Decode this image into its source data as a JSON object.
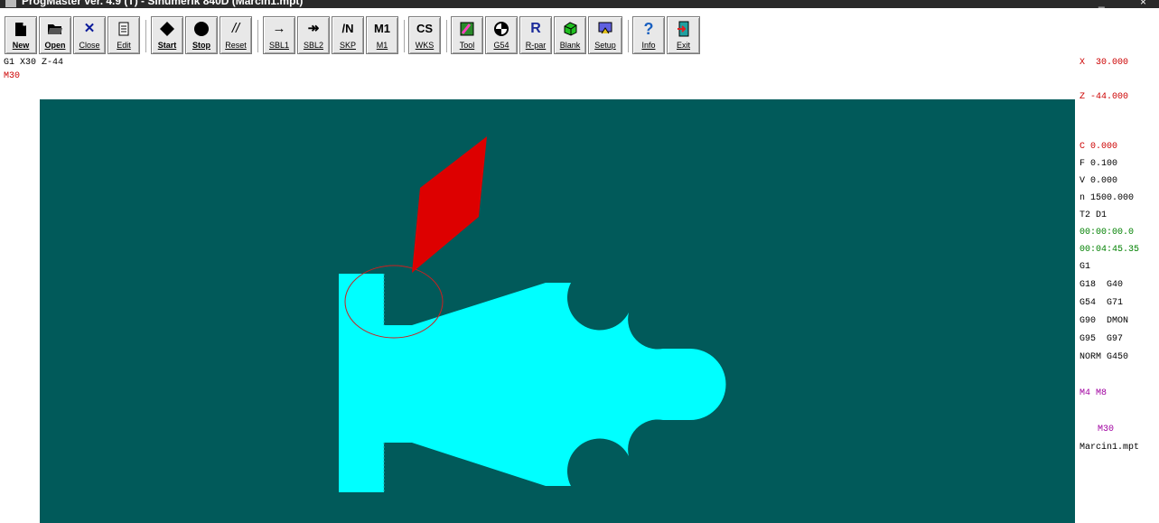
{
  "window": {
    "title": "ProgMaster ver. 4.9 (T) - Sinumerik 840D (Marcin1.mpt)",
    "minimize": "_",
    "close": "×"
  },
  "toolbar": {
    "buttons": [
      {
        "id": "new",
        "label": "New",
        "icon": "new-file-icon"
      },
      {
        "id": "open",
        "label": "Open",
        "icon": "open-folder-icon"
      },
      {
        "id": "close",
        "label": "Close",
        "icon": "close-x-icon"
      },
      {
        "id": "edit",
        "label": "Edit",
        "icon": "edit-document-icon"
      },
      {
        "id": "start",
        "label": "Start",
        "icon": "start-diamond-icon"
      },
      {
        "id": "stop",
        "label": "Stop",
        "icon": "stop-circle-icon"
      },
      {
        "id": "reset",
        "label": "Reset",
        "glyph": "//"
      },
      {
        "id": "sbl1",
        "label": "SBL1",
        "glyph": "→"
      },
      {
        "id": "sbl2",
        "label": "SBL2",
        "glyph": "↠"
      },
      {
        "id": "skp",
        "label": "SKP",
        "glyph": "/N"
      },
      {
        "id": "m1",
        "label": "M1",
        "glyph": "M1"
      },
      {
        "id": "wks",
        "label": "WKS",
        "glyph": "CS"
      },
      {
        "id": "tool",
        "label": "Tool",
        "icon": "tool-icon"
      },
      {
        "id": "g54",
        "label": "G54",
        "icon": "g54-origin-icon"
      },
      {
        "id": "rpar",
        "label": "R-par",
        "glyph": "R"
      },
      {
        "id": "blank",
        "label": "Blank",
        "icon": "blank-cube-icon"
      },
      {
        "id": "setup",
        "label": "Setup",
        "icon": "setup-icon"
      },
      {
        "id": "info",
        "label": "Info",
        "glyph": "?"
      },
      {
        "id": "exit",
        "label": "Exit",
        "icon": "exit-door-icon"
      }
    ]
  },
  "program": {
    "current_block": "G1 X30 Z-44",
    "next_block": "M30"
  },
  "status": {
    "x": "X  30.000",
    "z": "Z -44.000",
    "c": "C 0.000",
    "f": "F 0.100",
    "v": "V 0.000",
    "n": "n 1500.000",
    "tool": "T2 D1",
    "time1": "00:00:00.0",
    "time2": "00:04:45.35",
    "gcode1": "G1",
    "gcode2": "G18  G40",
    "gcode3": "G54  G71",
    "gcode4": "G90  DMON",
    "gcode5": "G95  G97",
    "gcode6": "NORM G450",
    "mcodes": "M4 M8",
    "end": "M30",
    "file": "Marcin1.mpt"
  },
  "colors": {
    "viewport_bg": "#015a5a",
    "workpiece": "#00ffff",
    "tool": "#dd0000",
    "coord_text": "#cc0000",
    "time_text": "#008000",
    "m_text": "#a000a0"
  }
}
